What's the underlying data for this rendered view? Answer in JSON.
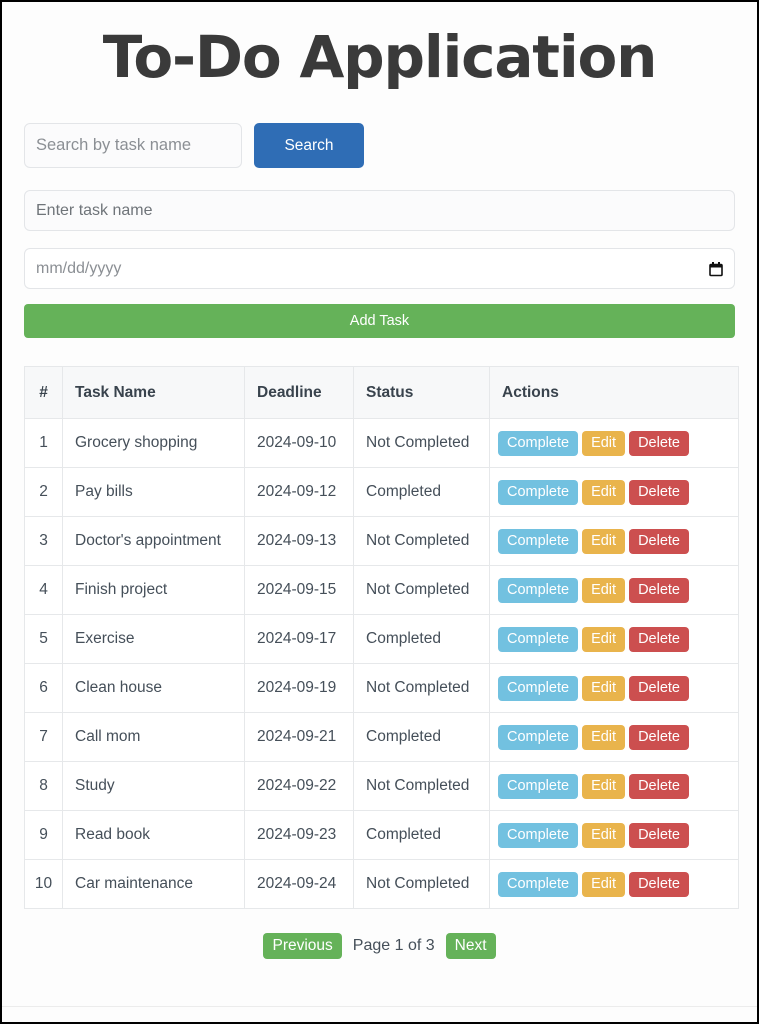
{
  "header": {
    "title": "To-Do Application"
  },
  "search": {
    "placeholder": "Search by task name",
    "value": "",
    "button_label": "Search"
  },
  "add_form": {
    "task_name_placeholder": "Enter task name",
    "task_name_value": "",
    "date_placeholder": "mm/dd/yyyy",
    "date_value": "",
    "calendar_icon": "calendar-icon",
    "submit_label": "Add Task"
  },
  "table": {
    "columns": [
      "#",
      "Task Name",
      "Deadline",
      "Status",
      "Actions"
    ],
    "action_labels": {
      "complete": "Complete",
      "edit": "Edit",
      "delete": "Delete"
    },
    "rows": [
      {
        "index": "1",
        "name": "Grocery shopping",
        "deadline": "2024-09-10",
        "status": "Not Completed"
      },
      {
        "index": "2",
        "name": "Pay bills",
        "deadline": "2024-09-12",
        "status": "Completed"
      },
      {
        "index": "3",
        "name": "Doctor's appointment",
        "deadline": "2024-09-13",
        "status": "Not Completed"
      },
      {
        "index": "4",
        "name": "Finish project",
        "deadline": "2024-09-15",
        "status": "Not Completed"
      },
      {
        "index": "5",
        "name": "Exercise",
        "deadline": "2024-09-17",
        "status": "Completed"
      },
      {
        "index": "6",
        "name": "Clean house",
        "deadline": "2024-09-19",
        "status": "Not Completed"
      },
      {
        "index": "7",
        "name": "Call mom",
        "deadline": "2024-09-21",
        "status": "Completed"
      },
      {
        "index": "8",
        "name": "Study",
        "deadline": "2024-09-22",
        "status": "Not Completed"
      },
      {
        "index": "9",
        "name": "Read book",
        "deadline": "2024-09-23",
        "status": "Completed"
      },
      {
        "index": "10",
        "name": "Car maintenance",
        "deadline": "2024-09-24",
        "status": "Not Completed"
      }
    ]
  },
  "pagination": {
    "previous_label": "Previous",
    "page_label": "Page 1 of 3",
    "next_label": "Next"
  },
  "colors": {
    "title": "#3a3a3a",
    "search_button": "#2f6db5",
    "add_task_button": "#65b259",
    "complete_button": "#72c1e0",
    "edit_button": "#e9b44c",
    "delete_button": "#cc4f4f",
    "page_button": "#65b259",
    "table_header_bg": "#f7f8f9",
    "border": "#e6e8ea"
  }
}
